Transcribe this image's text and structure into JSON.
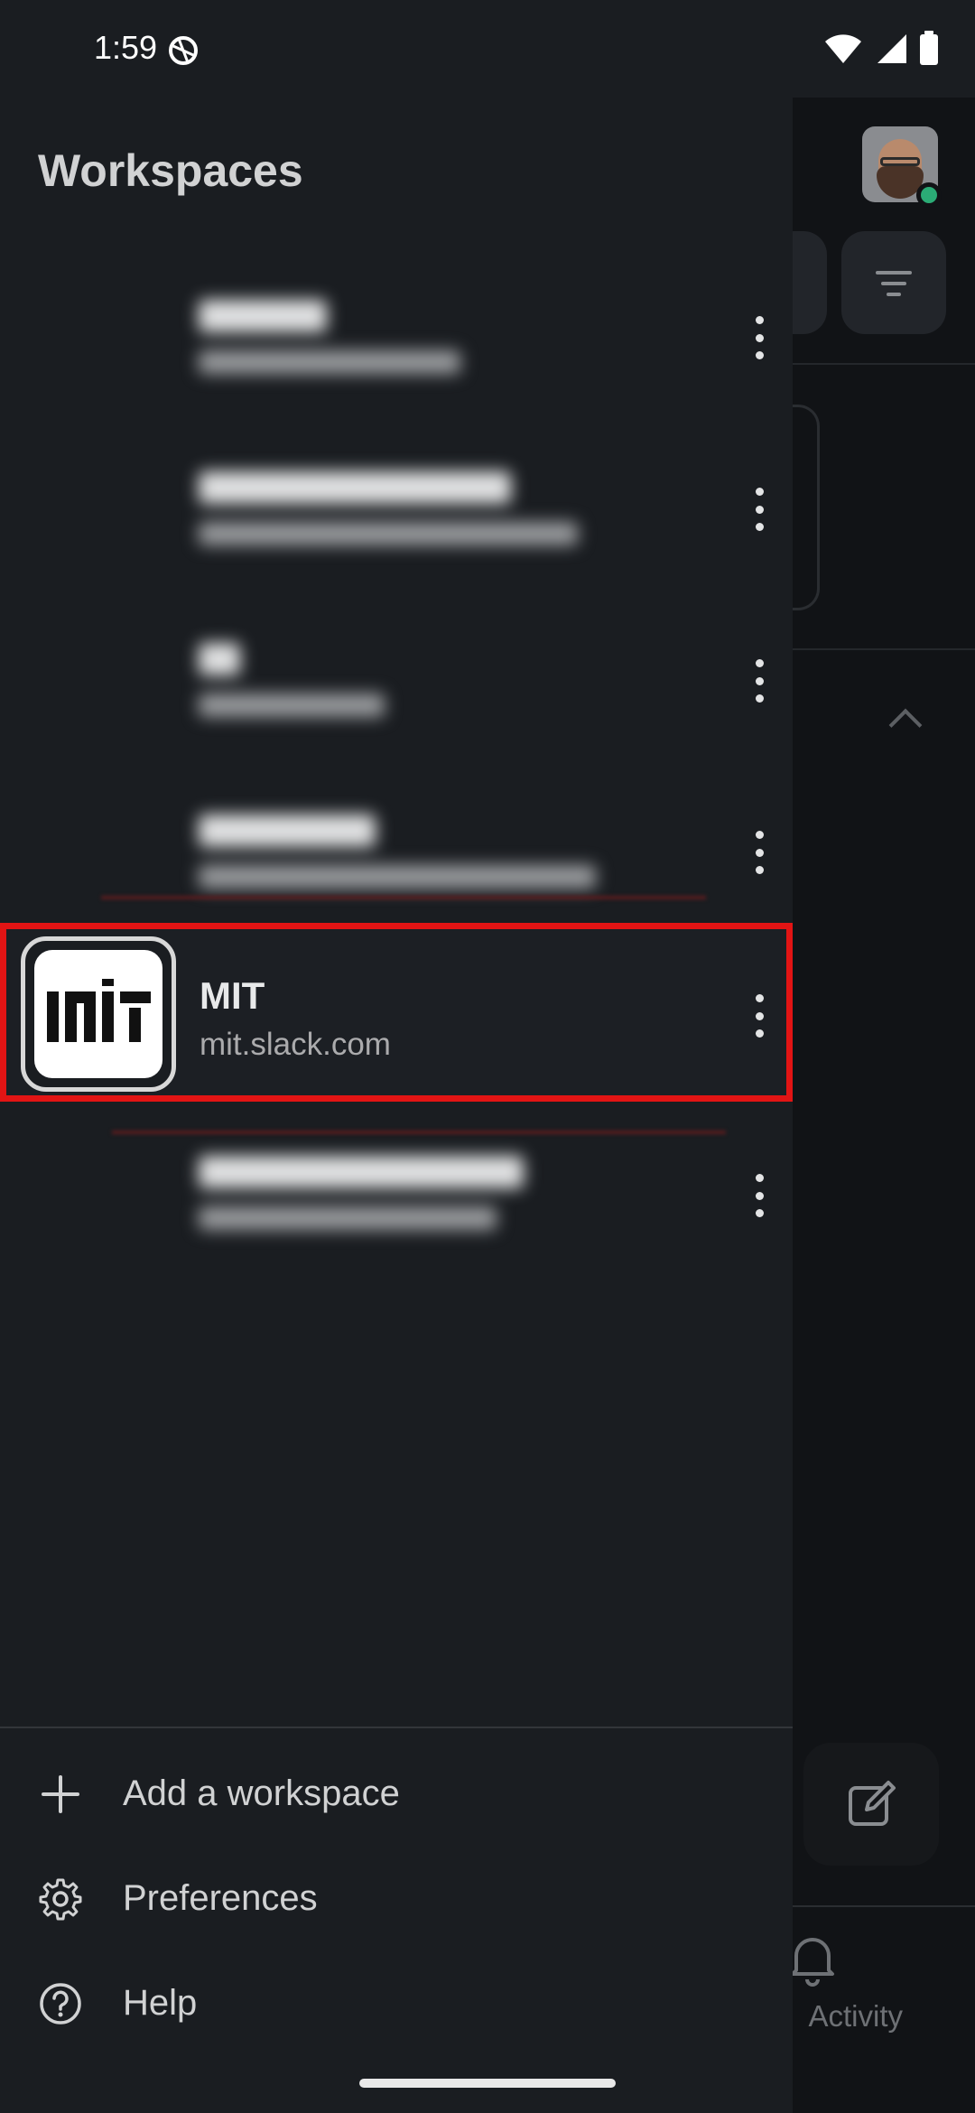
{
  "status_bar": {
    "time": "1:59"
  },
  "drawer": {
    "title": "Workspaces",
    "selected_workspace": {
      "name": "MIT",
      "url": "mit.slack.com"
    },
    "footer_menu": [
      {
        "label": "Add a workspace",
        "icon": "plus-icon"
      },
      {
        "label": "Preferences",
        "icon": "gear-icon"
      },
      {
        "label": "Help",
        "icon": "help-circle-icon"
      }
    ]
  },
  "background": {
    "activity_label": "Activity"
  },
  "colors": {
    "drawer_bg": "#1a1d21",
    "highlight": "#e21414",
    "text": "#d1d2d3",
    "online": "#2bac76"
  }
}
